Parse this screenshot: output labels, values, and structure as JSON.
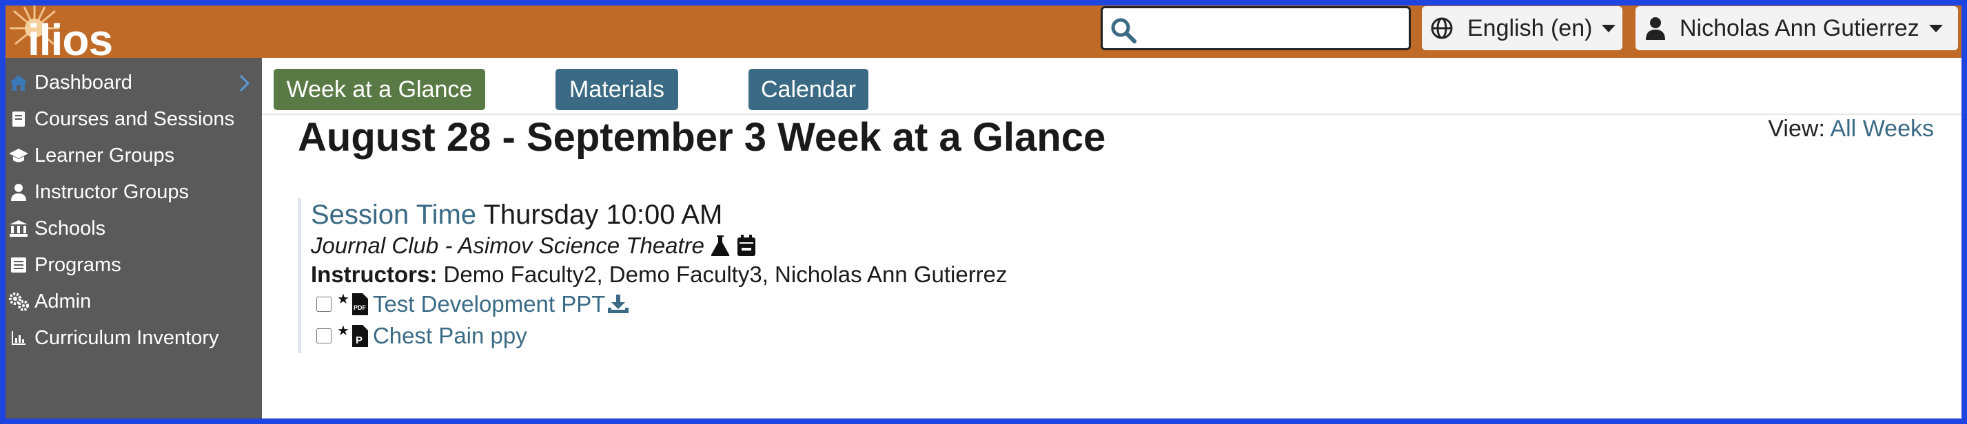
{
  "app": {
    "logo_text": "ilios"
  },
  "header": {
    "search": {
      "placeholder": "",
      "value": ""
    },
    "language": {
      "label": "English (en)"
    },
    "user": {
      "name": "Nicholas Ann Gutierrez"
    }
  },
  "sidebar": {
    "items": [
      {
        "label": "Dashboard",
        "icon": "home-icon"
      },
      {
        "label": "Courses and Sessions",
        "icon": "book-icon"
      },
      {
        "label": "Learner Groups",
        "icon": "graduation-cap-icon"
      },
      {
        "label": "Instructor Groups",
        "icon": "user-tie-icon"
      },
      {
        "label": "Schools",
        "icon": "university-icon"
      },
      {
        "label": "Programs",
        "icon": "list-icon"
      },
      {
        "label": "Admin",
        "icon": "cogs-icon"
      },
      {
        "label": "Curriculum Inventory",
        "icon": "chart-icon"
      }
    ]
  },
  "tabs": {
    "week": "Week at a Glance",
    "materials": "Materials",
    "calendar": "Calendar"
  },
  "main": {
    "title": "August 28 - September 3 Week at a Glance",
    "view_label": "View:",
    "view_link": "All Weeks"
  },
  "event": {
    "time_label": "Session Time",
    "time_value": "Thursday 10:00 AM",
    "title": "Journal Club - Asimov Science Theatre",
    "instructors_label": "Instructors:",
    "instructors": "Demo Faculty2, Demo Faculty3, Nicholas Ann Gutierrez",
    "materials": [
      {
        "title": "Test Development PPT",
        "type": "pdf",
        "checked": false
      },
      {
        "title": "Chest Pain ppy",
        "type": "powerpoint",
        "checked": false
      }
    ]
  },
  "colors": {
    "header": "#c06a28",
    "sidebar": "#5a5a5a",
    "tab_active": "#5a7a45",
    "tab": "#3a6a84",
    "link": "#3a6a84",
    "frame": "#1f45e0"
  }
}
